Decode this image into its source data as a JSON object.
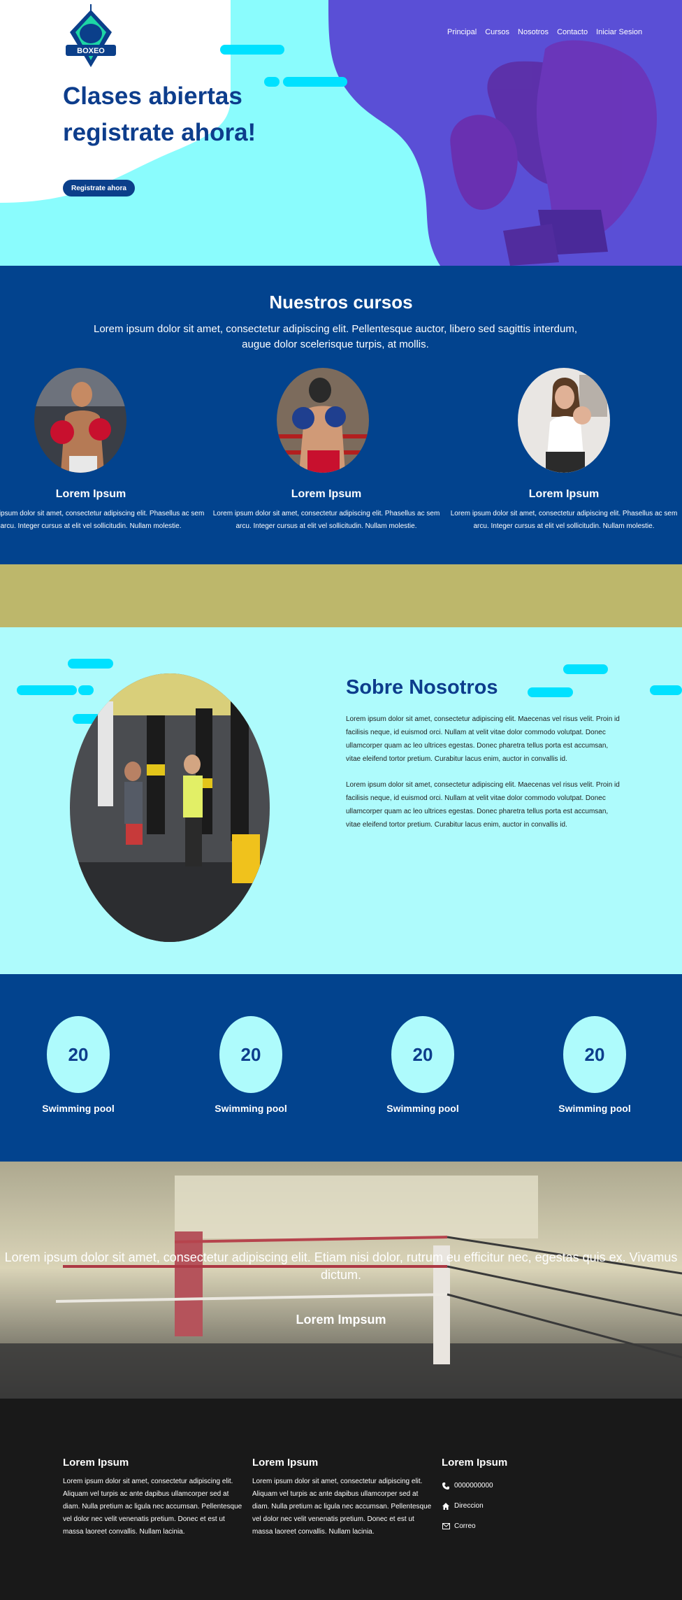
{
  "hero": {
    "logo_text": "BOXEO",
    "nav": [
      "Principal",
      "Cursos",
      "Nosotros",
      "Contacto",
      "Iniciar Sesion"
    ],
    "title_line1": "Clases abiertas",
    "title_line2": "registrate ahora!",
    "cta_label": "Registrate ahora"
  },
  "courses": {
    "title": "Nuestros cursos",
    "intro": "Lorem ipsum dolor sit amet, consectetur adipiscing elit. Pellentesque auctor, libero sed sagittis interdum, augue dolor scelerisque turpis, at mollis.",
    "items": [
      {
        "title": "Lorem Ipsum",
        "text": "Lorem ipsum dolor sit amet, consectetur adipiscing elit. Phasellus ac sem arcu. Integer cursus at elit vel sollicitudin. Nullam molestie."
      },
      {
        "title": "Lorem Ipsum",
        "text": "Lorem ipsum dolor sit amet, consectetur adipiscing elit. Phasellus ac sem arcu. Integer cursus at elit vel sollicitudin. Nullam molestie."
      },
      {
        "title": "Lorem Ipsum",
        "text": "Lorem ipsum dolor sit amet, consectetur adipiscing elit. Phasellus ac sem arcu. Integer cursus at elit vel sollicitudin. Nullam molestie."
      }
    ]
  },
  "about": {
    "title": "Sobre Nosotros",
    "p1": "Lorem ipsum dolor sit amet, consectetur adipiscing elit. Maecenas vel risus velit. Proin id facilisis neque, id euismod orci. Nullam at velit vitae dolor commodo volutpat. Donec ullamcorper quam ac leo ultrices egestas. Donec pharetra tellus porta est accumsan, vitae eleifend tortor pretium. Curabitur lacus enim, auctor in convallis id.",
    "p2": "Lorem ipsum dolor sit amet, consectetur adipiscing elit. Maecenas vel risus velit. Proin id facilisis neque, id euismod orci. Nullam at velit vitae dolor commodo volutpat. Donec ullamcorper quam ac leo ultrices egestas. Donec pharetra tellus porta est accumsan, vitae eleifend tortor pretium. Curabitur lacus enim, auctor in convallis id."
  },
  "stats": [
    {
      "value": "20",
      "label": "Swimming pool"
    },
    {
      "value": "20",
      "label": "Swimming pool"
    },
    {
      "value": "20",
      "label": "Swimming pool"
    },
    {
      "value": "20",
      "label": "Swimming pool"
    }
  ],
  "ring": {
    "text": "Lorem ipsum dolor sit amet, consectetur adipiscing elit. Etiam nisi dolor, rutrum eu efficitur nec, egestas quis ex. Vivamus dictum.",
    "subtitle": "Lorem Impsum"
  },
  "footer": {
    "col1": {
      "title": "Lorem Ipsum",
      "text": "Lorem ipsum dolor sit amet, consectetur adipiscing elit. Aliquam vel turpis ac ante dapibus ullamcorper sed at diam. Nulla pretium ac ligula nec accumsan. Pellentesque vel dolor nec velit venenatis pretium. Donec et est ut massa laoreet convallis. Nullam lacinia."
    },
    "col2": {
      "title": "Lorem Ipsum",
      "text": "Lorem ipsum dolor sit amet, consectetur adipiscing elit. Aliquam vel turpis ac ante dapibus ullamcorper sed at diam. Nulla pretium ac ligula nec accumsan. Pellentesque vel dolor nec velit venenatis pretium. Donec et est ut massa laoreet convallis. Nullam lacinia."
    },
    "col3": {
      "title": "Lorem Ipsum",
      "phone": "0000000000",
      "address": "Direccion",
      "email": "Correo"
    }
  },
  "colors": {
    "navy": "#02438e",
    "cyan": "#aefbfc",
    "olive": "#bdb76b",
    "purple": "#5a4fd6",
    "footer": "#191919"
  },
  "icons": [
    "boxing-glove-logo-icon",
    "phone-icon",
    "home-icon",
    "mail-icon"
  ]
}
